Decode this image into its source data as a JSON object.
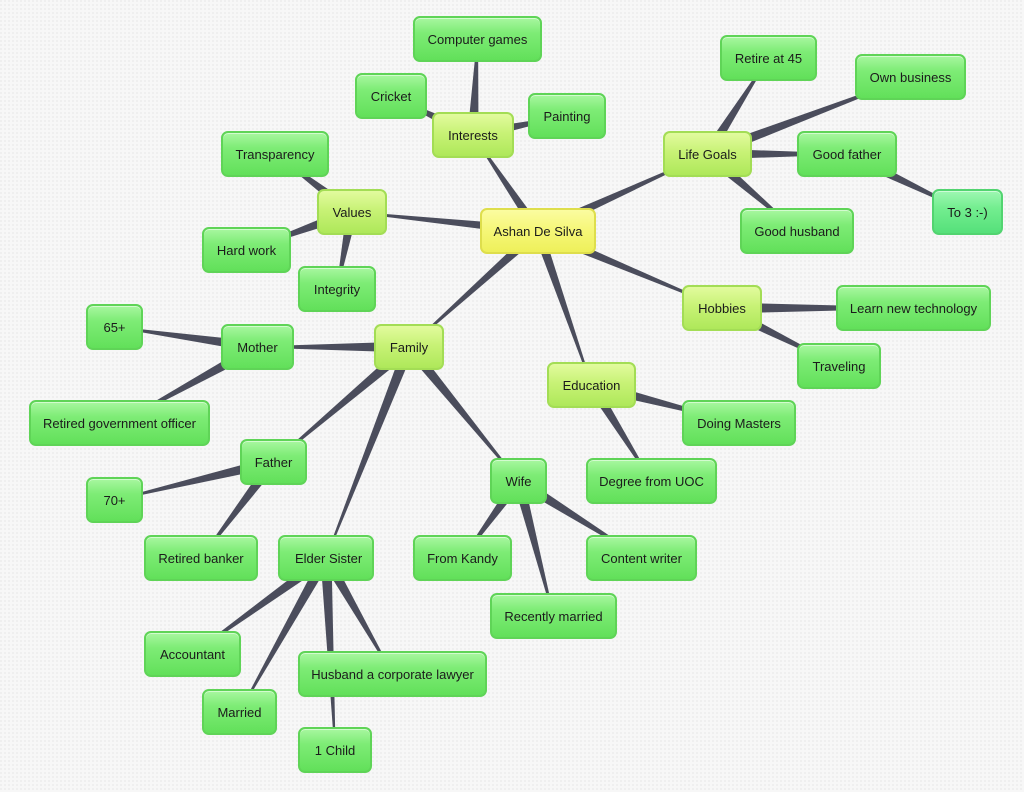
{
  "mindmap": {
    "root": "Ashan De Silva",
    "colors": {
      "root": "#f4f66e",
      "branch": "#c3f06e",
      "leaf": "#74ea6c",
      "connector": "#4b4d5c"
    },
    "nodes": [
      {
        "id": "root",
        "label": "Ashan De Silva",
        "level": "root"
      },
      {
        "id": "interests",
        "label": "Interests",
        "level": "branch",
        "parent": "root"
      },
      {
        "id": "computer-games",
        "label": "Computer games",
        "level": "leaf",
        "parent": "interests"
      },
      {
        "id": "cricket",
        "label": "Cricket",
        "level": "leaf",
        "parent": "interests"
      },
      {
        "id": "painting",
        "label": "Painting",
        "level": "leaf",
        "parent": "interests"
      },
      {
        "id": "life-goals",
        "label": "Life Goals",
        "level": "branch",
        "parent": "root"
      },
      {
        "id": "retire-at-45",
        "label": "Retire at 45",
        "level": "leaf",
        "parent": "life-goals"
      },
      {
        "id": "own-business",
        "label": "Own business",
        "level": "leaf",
        "parent": "life-goals"
      },
      {
        "id": "good-father",
        "label": "Good father",
        "level": "leaf",
        "parent": "life-goals"
      },
      {
        "id": "to-3",
        "label": "To 3 :-)",
        "level": "leaf-alt",
        "parent": "good-father"
      },
      {
        "id": "good-husband",
        "label": "Good husband",
        "level": "leaf",
        "parent": "life-goals"
      },
      {
        "id": "values",
        "label": "Values",
        "level": "branch",
        "parent": "root"
      },
      {
        "id": "transparency",
        "label": "Transparency",
        "level": "leaf",
        "parent": "values"
      },
      {
        "id": "hard-work",
        "label": "Hard work",
        "level": "leaf",
        "parent": "values"
      },
      {
        "id": "integrity",
        "label": "Integrity",
        "level": "leaf",
        "parent": "values"
      },
      {
        "id": "hobbies",
        "label": "Hobbies",
        "level": "branch",
        "parent": "root"
      },
      {
        "id": "learn-new-technology",
        "label": "Learn new technology",
        "level": "leaf",
        "parent": "hobbies"
      },
      {
        "id": "traveling",
        "label": "Traveling",
        "level": "leaf",
        "parent": "hobbies"
      },
      {
        "id": "education",
        "label": "Education",
        "level": "branch",
        "parent": "root"
      },
      {
        "id": "doing-masters",
        "label": "Doing Masters",
        "level": "leaf",
        "parent": "education"
      },
      {
        "id": "degree-from-uoc",
        "label": "Degree from UOC",
        "level": "leaf",
        "parent": "education"
      },
      {
        "id": "family",
        "label": "Family",
        "level": "branch",
        "parent": "root"
      },
      {
        "id": "mother",
        "label": "Mother",
        "level": "leaf",
        "parent": "family"
      },
      {
        "id": "mother-age",
        "label": "65+",
        "level": "leaf",
        "parent": "mother"
      },
      {
        "id": "retired-government-officer",
        "label": "Retired government officer",
        "level": "leaf",
        "parent": "mother"
      },
      {
        "id": "father",
        "label": "Father",
        "level": "leaf",
        "parent": "family"
      },
      {
        "id": "father-age",
        "label": "70+",
        "level": "leaf",
        "parent": "father"
      },
      {
        "id": "retired-banker",
        "label": "Retired banker",
        "level": "leaf",
        "parent": "father"
      },
      {
        "id": "elder-sister",
        "label": "Elder Sister",
        "level": "leaf",
        "parent": "family"
      },
      {
        "id": "accountant",
        "label": "Accountant",
        "level": "leaf",
        "parent": "elder-sister"
      },
      {
        "id": "married",
        "label": "Married",
        "level": "leaf",
        "parent": "elder-sister"
      },
      {
        "id": "husband-lawyer",
        "label": "Husband a corporate lawyer",
        "level": "leaf",
        "parent": "elder-sister"
      },
      {
        "id": "one-child",
        "label": "1 Child",
        "level": "leaf",
        "parent": "elder-sister"
      },
      {
        "id": "wife",
        "label": "Wife",
        "level": "leaf",
        "parent": "family"
      },
      {
        "id": "from-kandy",
        "label": "From Kandy",
        "level": "leaf",
        "parent": "wife"
      },
      {
        "id": "recently-married",
        "label": "Recently married",
        "level": "leaf",
        "parent": "wife"
      },
      {
        "id": "content-writer",
        "label": "Content writer",
        "level": "leaf",
        "parent": "wife"
      }
    ]
  }
}
